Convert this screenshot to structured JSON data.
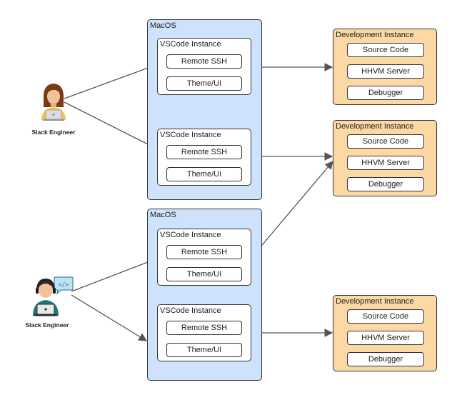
{
  "engineers": [
    {
      "label": "Slack Engineer",
      "icon": "female-engineer-laptop-icon"
    },
    {
      "label": "Slack Engineer",
      "icon": "male-developer-headset-code-icon"
    }
  ],
  "macos": [
    {
      "title": "MacOS",
      "vscode": [
        {
          "title": "VSCode Instance",
          "items": [
            "Remote SSH",
            "Theme/UI"
          ]
        },
        {
          "title": "VSCode Instance",
          "items": [
            "Remote SSH",
            "Theme/UI"
          ]
        }
      ]
    },
    {
      "title": "MacOS",
      "vscode": [
        {
          "title": "VSCode Instance",
          "items": [
            "Remote SSH",
            "Theme/UI"
          ]
        },
        {
          "title": "VSCode Instance",
          "items": [
            "Remote SSH",
            "Theme/UI"
          ]
        }
      ]
    }
  ],
  "dev_instances": [
    {
      "title": "Development Instance",
      "items": [
        "Source Code",
        "HHVM Server",
        "Debugger"
      ]
    },
    {
      "title": "Development Instance",
      "items": [
        "Source Code",
        "HHVM Server",
        "Debugger"
      ]
    },
    {
      "title": "Development Instance",
      "items": [
        "Source Code",
        "HHVM Server",
        "Debugger"
      ]
    }
  ],
  "colors": {
    "macos_fill": "#cfe2fb",
    "dev_fill": "#fcd9a4",
    "border": "#2f3437",
    "arrow": "#555555"
  }
}
